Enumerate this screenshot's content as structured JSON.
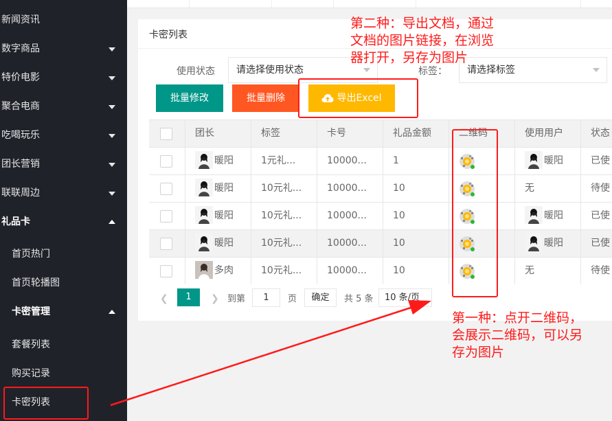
{
  "sidebar": {
    "items": [
      {
        "label": "新闻资讯",
        "expanded": false,
        "has_arrow": false
      },
      {
        "label": "数字商品",
        "expanded": false,
        "has_arrow": true
      },
      {
        "label": "特价电影",
        "expanded": false,
        "has_arrow": true
      },
      {
        "label": "聚合电商",
        "expanded": false,
        "has_arrow": true
      },
      {
        "label": "吃喝玩乐",
        "expanded": false,
        "has_arrow": true
      },
      {
        "label": "团长营销",
        "expanded": false,
        "has_arrow": true
      },
      {
        "label": "联联周边",
        "expanded": false,
        "has_arrow": true
      },
      {
        "label": "礼品卡",
        "expanded": true,
        "has_arrow": true
      }
    ],
    "sub_items": [
      {
        "label": "首页热门"
      },
      {
        "label": "首页轮播图"
      },
      {
        "label": "卡密管理",
        "expanded": true
      },
      {
        "label": "套餐列表"
      },
      {
        "label": "购买记录"
      },
      {
        "label": "卡密列表",
        "active": true
      }
    ]
  },
  "card": {
    "title": "卡密列表",
    "filters": {
      "status_label": "使用状态",
      "status_placeholder": "请选择使用状态",
      "tag_label": "标签：",
      "tag_placeholder": "请选择标签"
    },
    "buttons": {
      "batch_edit": "批量修改",
      "batch_delete": "批量删除",
      "export": "导出Excel"
    }
  },
  "table": {
    "columns": [
      "团长",
      "标签",
      "卡号",
      "礼品金额",
      "二维码",
      "使用用户",
      "状态"
    ],
    "rows": [
      {
        "leader": "暖阳",
        "tag": "1元礼...",
        "card_no": "10000...",
        "amount": "1",
        "user": "暖阳",
        "status": "已使"
      },
      {
        "leader": "暖阳",
        "tag": "10元礼...",
        "card_no": "10000...",
        "amount": "10",
        "user": "无",
        "status": "待使"
      },
      {
        "leader": "暖阳",
        "tag": "10元礼...",
        "card_no": "10000...",
        "amount": "10",
        "user": "暖阳",
        "status": "已使"
      },
      {
        "leader": "暖阳",
        "tag": "10元礼...",
        "card_no": "10000...",
        "amount": "10",
        "user": "暖阳",
        "status": "已使"
      },
      {
        "leader": "多肉",
        "tag": "10元礼...",
        "card_no": "10000...",
        "amount": "10",
        "user": "无",
        "status": "待使"
      }
    ]
  },
  "pagination": {
    "current": "1",
    "goto_label": "到第",
    "goto_value": "1",
    "page_unit": "页",
    "confirm": "确定",
    "total": "共 5 条",
    "page_size": "10 条/页"
  },
  "annotations": {
    "method2": [
      "第二种：导出文档，通过",
      "文档的图片链接，在浏览",
      "器打开，另存为图片"
    ],
    "method1": [
      "第一种：点开二维码，",
      "会展示二维码，可以另",
      "存为图片"
    ],
    "color": "#ff1a1a"
  },
  "colors": {
    "sidebar_bg": "#20222a",
    "teal": "#009688",
    "orange": "#ff5722",
    "yellow": "#ffb800"
  }
}
